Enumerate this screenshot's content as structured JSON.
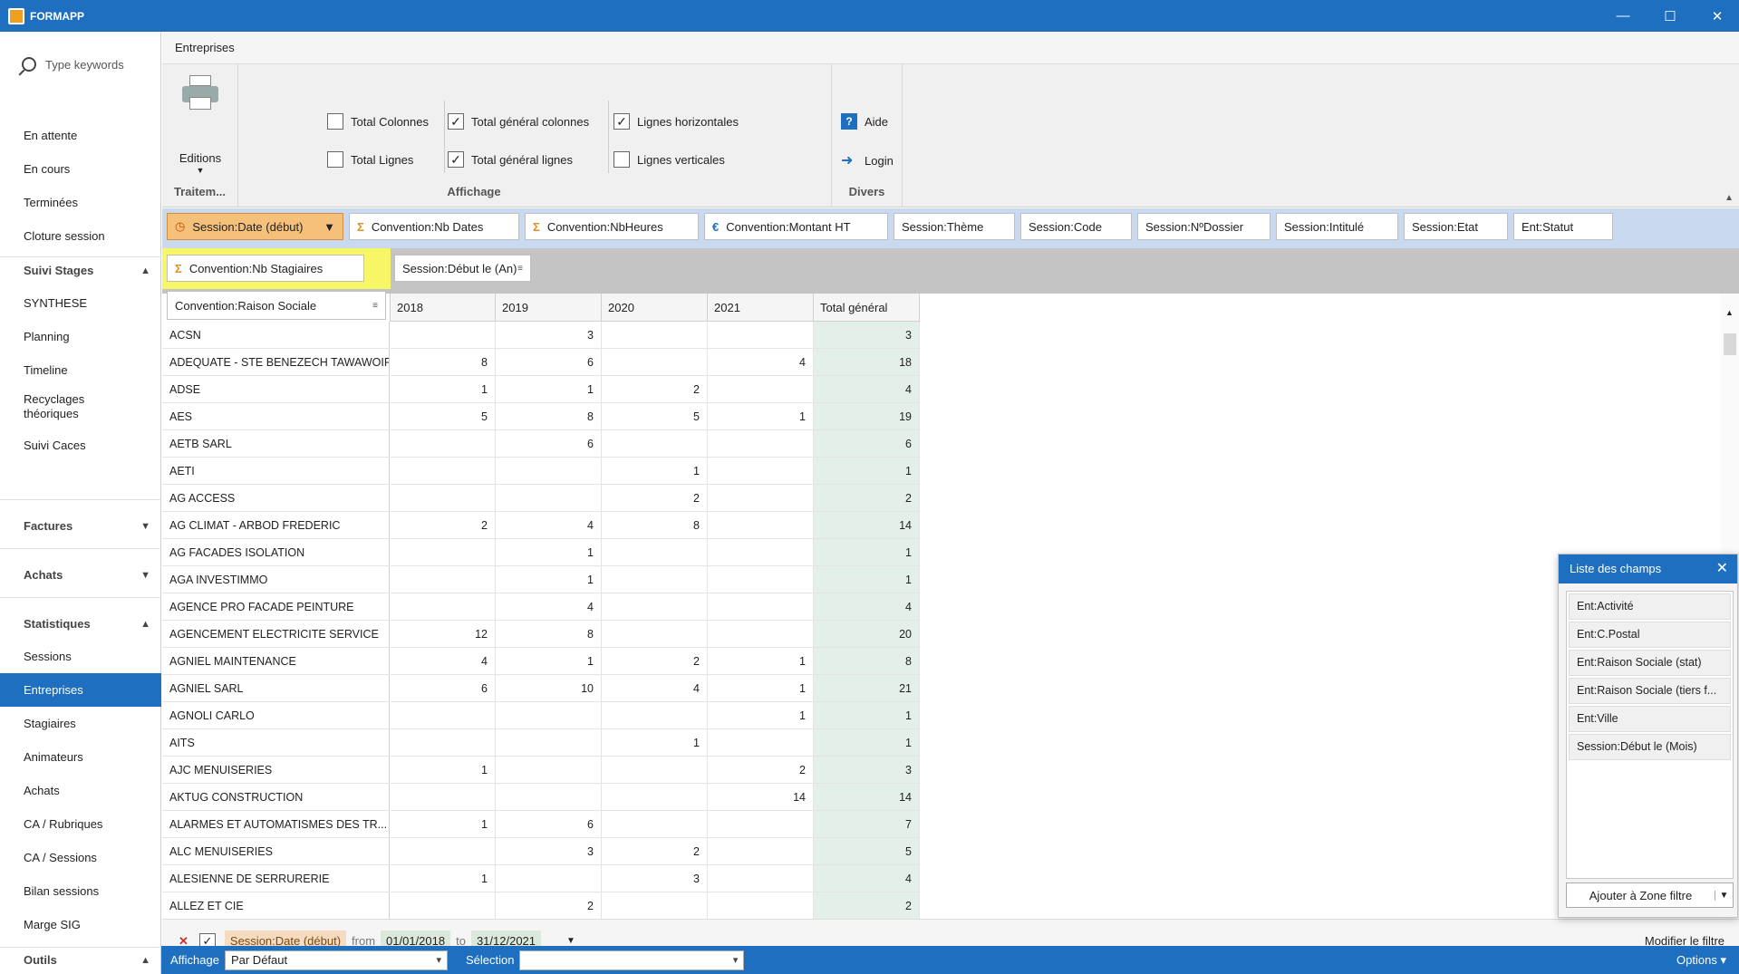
{
  "window": {
    "title": "FORMAPP"
  },
  "sidebar": {
    "search_placeholder": "Type keywords",
    "top_items": [
      "En attente",
      "En cours",
      "Terminées",
      "Cloture session"
    ],
    "groups": [
      {
        "label": "Suivi Stages",
        "items": [
          "SYNTHESE",
          "Planning",
          "Timeline",
          "Recyclages théoriques",
          "Suivi Caces"
        ]
      },
      {
        "label": "Factures",
        "items": []
      },
      {
        "label": "Achats",
        "items": []
      },
      {
        "label": "Statistiques",
        "items": [
          "Sessions",
          "Entreprises",
          "Stagiaires",
          "Animateurs",
          "Achats",
          "CA / Rubriques",
          "CA / Sessions",
          "Bilan sessions",
          "Marge SIG"
        ]
      },
      {
        "label": "Outils",
        "items": []
      }
    ],
    "active": "Entreprises"
  },
  "tab": {
    "title": "Entreprises"
  },
  "ribbon": {
    "editions_label": "Editions",
    "group_traitement": "Traitem...",
    "group_affichage": "Affichage",
    "group_divers": "Divers",
    "checks": [
      {
        "label": "Total Colonnes",
        "checked": false
      },
      {
        "label": "Total Lignes",
        "checked": false
      },
      {
        "label": "Total général colonnes",
        "checked": true
      },
      {
        "label": "Total général lignes",
        "checked": true
      },
      {
        "label": "Lignes horizontales",
        "checked": true
      },
      {
        "label": "Lignes verticales",
        "checked": false
      }
    ],
    "aide": "Aide",
    "login": "Login"
  },
  "filter_fields": [
    "Session:Date (début)",
    "Convention:Nb Dates",
    "Convention:NbHeures",
    "Convention:Montant HT",
    "Session:Thème",
    "Session:Code",
    "Session:NºDossier",
    "Session:Intitulé",
    "Session:Etat",
    "Ent:Statut"
  ],
  "data_field": "Convention:Nb Stagiaires",
  "column_field": "Session:Début le (An)",
  "row_field": "Convention:Raison Sociale",
  "columns": [
    "2018",
    "2019",
    "2020",
    "2021",
    "Total général"
  ],
  "rows": [
    {
      "name": "ACSN",
      "v": [
        "",
        "3",
        "",
        "",
        "3"
      ]
    },
    {
      "name": "ADEQUATE - STE BENEZECH TAWAWOIR",
      "v": [
        "8",
        "6",
        "",
        "4",
        "18"
      ]
    },
    {
      "name": "ADSE",
      "v": [
        "1",
        "1",
        "2",
        "",
        "4"
      ]
    },
    {
      "name": "AES",
      "v": [
        "5",
        "8",
        "5",
        "1",
        "19"
      ]
    },
    {
      "name": "AETB SARL",
      "v": [
        "",
        "6",
        "",
        "",
        "6"
      ]
    },
    {
      "name": "AETI",
      "v": [
        "",
        "",
        "1",
        "",
        "1"
      ]
    },
    {
      "name": "AG ACCESS",
      "v": [
        "",
        "",
        "2",
        "",
        "2"
      ]
    },
    {
      "name": "AG CLIMAT - ARBOD FREDERIC",
      "v": [
        "2",
        "4",
        "8",
        "",
        "14"
      ]
    },
    {
      "name": "AG FACADES ISOLATION",
      "v": [
        "",
        "1",
        "",
        "",
        "1"
      ]
    },
    {
      "name": "AGA INVESTIMMO",
      "v": [
        "",
        "1",
        "",
        "",
        "1"
      ]
    },
    {
      "name": "AGENCE PRO FACADE PEINTURE",
      "v": [
        "",
        "4",
        "",
        "",
        "4"
      ]
    },
    {
      "name": "AGENCEMENT ELECTRICITE SERVICE",
      "v": [
        "12",
        "8",
        "",
        "",
        "20"
      ]
    },
    {
      "name": "AGNIEL MAINTENANCE",
      "v": [
        "4",
        "1",
        "2",
        "1",
        "8"
      ]
    },
    {
      "name": "AGNIEL SARL",
      "v": [
        "6",
        "10",
        "4",
        "1",
        "21"
      ]
    },
    {
      "name": "AGNOLI CARLO",
      "v": [
        "",
        "",
        "",
        "1",
        "1"
      ]
    },
    {
      "name": "AITS",
      "v": [
        "",
        "",
        "1",
        "",
        "1"
      ]
    },
    {
      "name": "AJC MENUISERIES",
      "v": [
        "1",
        "",
        "",
        "2",
        "3"
      ]
    },
    {
      "name": "AKTUG CONSTRUCTION",
      "v": [
        "",
        "",
        "",
        "14",
        "14"
      ]
    },
    {
      "name": "ALARMES ET AUTOMATISMES DES TR...",
      "v": [
        "1",
        "6",
        "",
        "",
        "7"
      ]
    },
    {
      "name": "ALC MENUISERIES",
      "v": [
        "",
        "3",
        "2",
        "",
        "5"
      ]
    },
    {
      "name": "ALESIENNE DE SERRURERIE",
      "v": [
        "1",
        "",
        "3",
        "",
        "4"
      ]
    },
    {
      "name": "ALLEZ ET CIE",
      "v": [
        "",
        "2",
        "",
        "",
        "2"
      ]
    }
  ],
  "filter": {
    "field": "Session:Date (début)",
    "from_label": "from",
    "from": "01/01/2018",
    "to_label": "to",
    "to": "31/12/2021",
    "modify": "Modifier le filtre"
  },
  "field_list": {
    "title": "Liste des champs",
    "items": [
      "Ent:Activité",
      "Ent:C.Postal",
      "Ent:Raison Sociale (stat)",
      "Ent:Raison Sociale (tiers f...",
      "Ent:Ville",
      "Session:Début le (Mois)"
    ],
    "button": "Ajouter à Zone filtre"
  },
  "status": {
    "affichage_label": "Affichage",
    "affichage_value": "Par Défaut",
    "selection_label": "Sélection",
    "selection_value": "",
    "options": "Options"
  }
}
